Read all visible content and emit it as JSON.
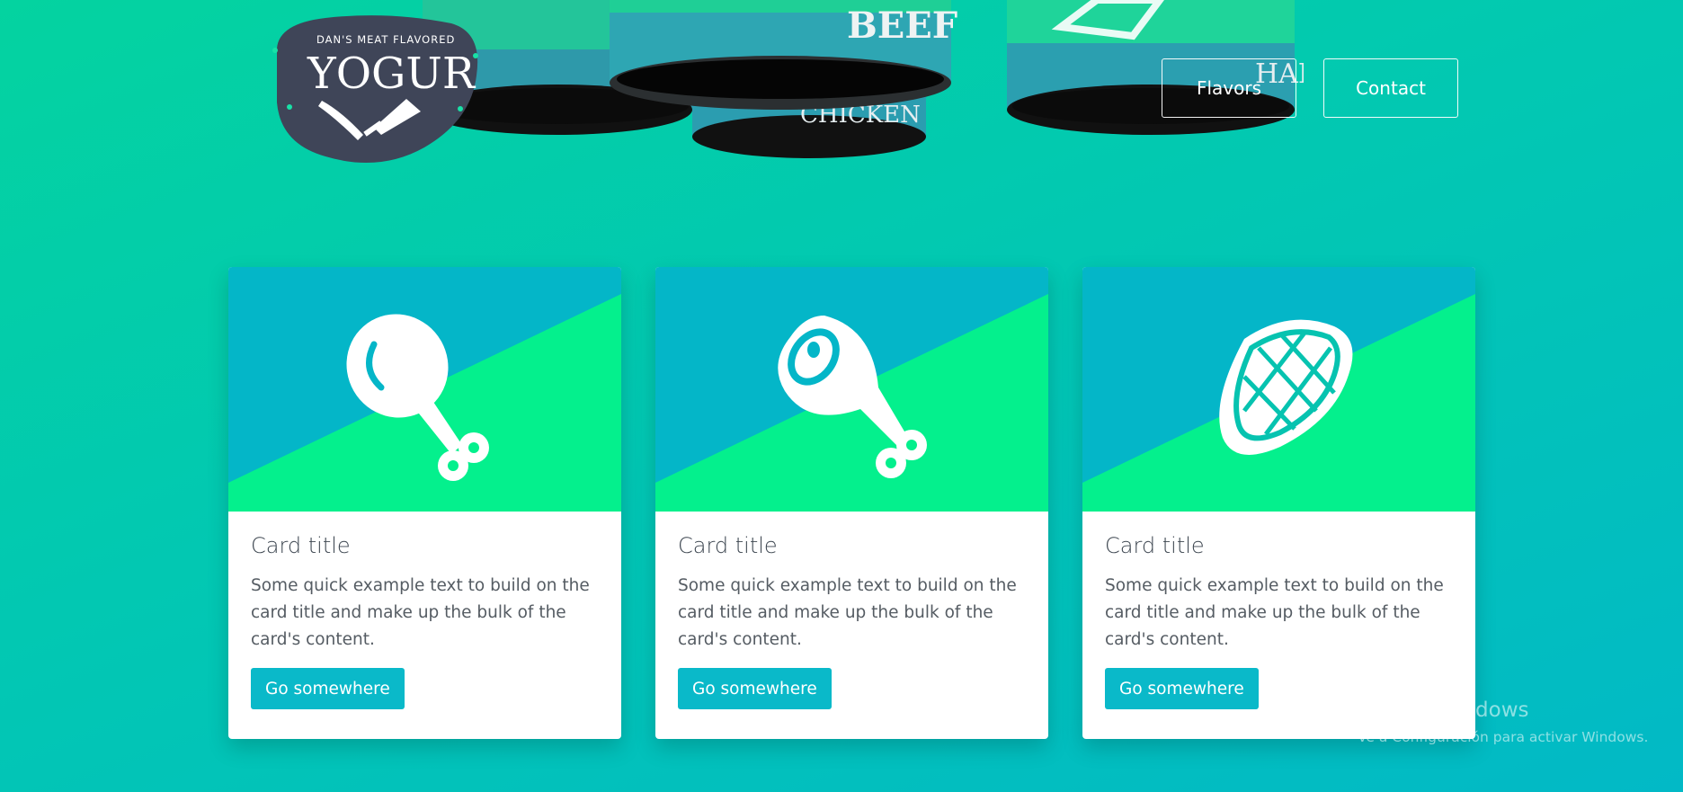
{
  "header": {
    "logo": {
      "tagline": "DAN'S MEAT FLAVORED",
      "wordmark": "YOGUR"
    },
    "cans": [
      {
        "label": "BEEF"
      },
      {
        "label": "CHICKEN"
      },
      {
        "label": "HAM"
      }
    ],
    "nav": {
      "flavors": "Flavors",
      "contact": "Contact"
    }
  },
  "cards": [
    {
      "icon": "chicken-leg-icon",
      "title": "Card title",
      "text": "Some quick example text to build on the card title and make up the bulk of the card's content.",
      "button": "Go somewhere"
    },
    {
      "icon": "ham-icon",
      "title": "Card title",
      "text": "Some quick example text to build on the card title and make up the bulk of the card's content.",
      "button": "Go somewhere"
    },
    {
      "icon": "steak-icon",
      "title": "Card title",
      "text": "Some quick example text to build on the card title and make up the bulk of the card's content.",
      "button": "Go somewhere"
    }
  ],
  "watermark": {
    "title": "Activar Windows",
    "subtitle": "Ve a Configuración para activar Windows."
  },
  "colors": {
    "background": "#03c7b0",
    "card_top": "#04b6c8",
    "card_bottom": "#04f08d",
    "button": "#0ab9c9",
    "logo_badge": "#3f4558"
  }
}
